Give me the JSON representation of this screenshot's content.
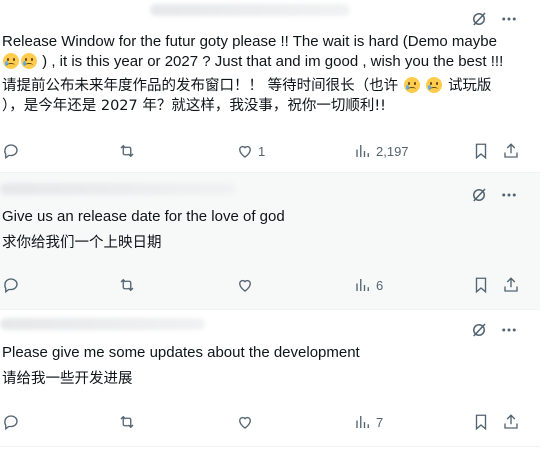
{
  "posts": [
    {
      "text_en_1": "Release Window for the futur goty please !! The wait is hard (Demo maybe",
      "text_en_2": ") , it is this year or 2027 ? Just that and im good , wish you the best !!!",
      "text_cn_1": "请提前公布未来年度作品的发布窗口！！ 等待时间很长（也许",
      "text_cn_1b": "试玩版",
      "text_cn_2": "），是今年还是 2027 年？就这样，我没事，祝你一切顺利!!",
      "replies": "",
      "reposts": "",
      "likes": "1",
      "views": "2,197"
    },
    {
      "text_en": "Give us an release date for the love of god",
      "text_cn": "求你给我们一个上映日期",
      "replies": "",
      "reposts": "",
      "likes": "",
      "views": "6"
    },
    {
      "text_en": "Please give me some updates about the development",
      "text_cn": "请给我一些开发进展",
      "replies": "",
      "reposts": "",
      "likes": "",
      "views": "7"
    }
  ],
  "icons": {
    "translate": "grok-slash-icon",
    "more": "more-dots-icon",
    "reply": "reply-icon",
    "repost": "repost-icon",
    "like": "heart-icon",
    "views": "views-bar-icon",
    "bookmark": "bookmark-icon",
    "share": "share-icon"
  },
  "colors": {
    "text": "#0f1419",
    "muted": "#536471",
    "hover_bg": "#f7f9f9",
    "emoji": "#ffcc4d"
  }
}
